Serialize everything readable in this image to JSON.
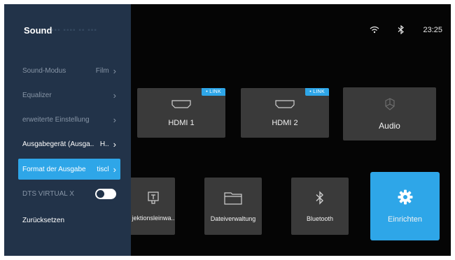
{
  "status": {
    "time": "23:25",
    "wifi_icon": "wifi-icon",
    "bluetooth_icon": "bluetooth-icon"
  },
  "sidebar": {
    "title": "Sound",
    "items": [
      {
        "label": "Sound-Modus",
        "value": "Film"
      },
      {
        "label": "Equalizer",
        "value": ""
      },
      {
        "label": "erweiterte Einstellung",
        "value": ""
      },
      {
        "label": "Ausgabegerät (Ausga..",
        "value": "H.."
      },
      {
        "label": "Format der Ausgabe",
        "value": "tiscl"
      },
      {
        "label": "DTS VIRTUAL X",
        "toggle": "on"
      },
      {
        "label": "Zurücksetzen"
      }
    ]
  },
  "tiles": {
    "hdmi1": {
      "label": "HDMI 1",
      "badge": "• LINK"
    },
    "hdmi2": {
      "label": "HDMI 2",
      "badge": "• LINK"
    },
    "audio": {
      "label": "Audio"
    },
    "projection": {
      "label": "jektionsleinwa.."
    },
    "files": {
      "label": "Dateiverwaltung"
    },
    "bluetooth": {
      "label": "Bluetooth"
    },
    "setup": {
      "label": "Einrichten"
    }
  },
  "colors": {
    "accent": "#2ea6e8",
    "sidebar": "#223349",
    "tile": "#3a3a3a"
  }
}
